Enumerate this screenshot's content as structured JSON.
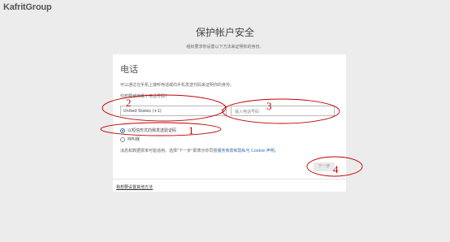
{
  "app": {
    "logo": "KafritGroup"
  },
  "header": {
    "title": "保护帐户安全",
    "subtitle": "组织要求你设置以下方法来证明你的身份。"
  },
  "card": {
    "title": "电话",
    "description": "可以通过在手机上接听电话或向手机发送代码来证明你的身份。",
    "question": "你想要使用哪个电话号码?",
    "country_select": {
      "value": "United States (+1)"
    },
    "phone_input": {
      "placeholder": "输入电话号码"
    },
    "options": [
      {
        "label": "以短信形式向我发送验证码",
        "checked": true
      },
      {
        "label": "呼叫我",
        "checked": false
      }
    ],
    "rates_text": "消息和数据费率可能适用。选择\"下一步\"即表示你同意",
    "terms_link": "服务条款",
    "and_text": "和",
    "privacy_link": "隐私与 Cookie 声明",
    "period": "。",
    "next_button": "下一步",
    "alternate_link": "我想要设置其他方法"
  },
  "annotations": [
    "2",
    "3",
    "1",
    "4"
  ],
  "colors": {
    "annotation": "#c00000",
    "link": "#2a6fb0"
  }
}
